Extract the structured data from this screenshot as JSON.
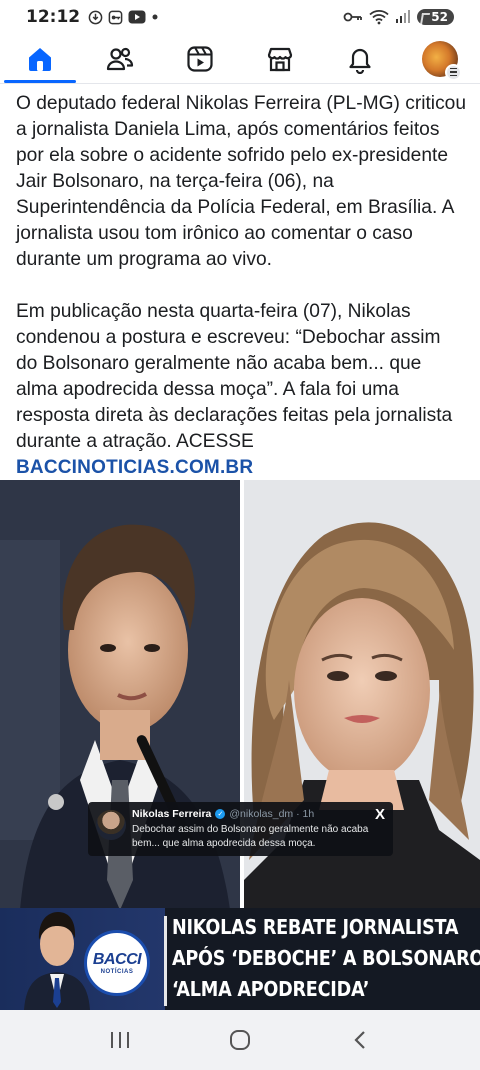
{
  "status_bar": {
    "time": "12:12",
    "left_icons": [
      "download-icon",
      "vpn-key-icon",
      "youtube-icon",
      "dot-icon"
    ],
    "right_icons": [
      "key-icon",
      "wifi-icon",
      "signal-icon"
    ],
    "battery": "52"
  },
  "nav": {
    "tabs": [
      {
        "name": "home",
        "icon": "home-icon",
        "active": true
      },
      {
        "name": "friends",
        "icon": "friends-icon",
        "active": false
      },
      {
        "name": "reels",
        "icon": "reels-icon",
        "active": false
      },
      {
        "name": "marketplace",
        "icon": "marketplace-icon",
        "active": false
      },
      {
        "name": "notifications",
        "icon": "bell-icon",
        "active": false
      },
      {
        "name": "profile",
        "icon": "avatar",
        "active": false
      }
    ],
    "accent_color": "#0866ff"
  },
  "post": {
    "paragraph1": "O deputado federal Nikolas Ferreira (PL-MG) criticou a jornalista Daniela Lima, após comentários feitos por ela sobre o acidente sofrido pelo ex-presidente Jair Bolsonaro, na terça-feira (06), na Superintendência da Polícia Federal, em Brasília. A jornalista usou tom irônico ao comentar o caso durante um programa ao vivo.",
    "paragraph2": "Em publicação nesta quarta-feira (07), Nikolas condenou a postura e escreveu: “Debochar assim do Bolsonaro geralmente não acaba bem... que alma apodrecida dessa moça”. A fala foi uma resposta direta às declarações feitas pela jornalista durante a atração. ACESSE",
    "link": "BACCINOTICIAS.COM.BR"
  },
  "image": {
    "tweet": {
      "name": "Nikolas Ferreira",
      "handle": "@nikolas_dm · 1h",
      "text": "Debochar assim do Bolsonaro geralmente não acaba bem... que alma apodrecida dessa moça.",
      "x_logo": "X"
    },
    "logo": {
      "main": "BACCI",
      "sub": "NOTÍCIAS"
    },
    "headline": [
      "NIKOLAS REBATE JORNALISTA",
      "APÓS ‘DEBOCHE’ A BOLSONARO:",
      "‘ALMA APODRECIDA’"
    ]
  },
  "system_nav": [
    "recents-icon",
    "home-circle-icon",
    "back-icon"
  ]
}
